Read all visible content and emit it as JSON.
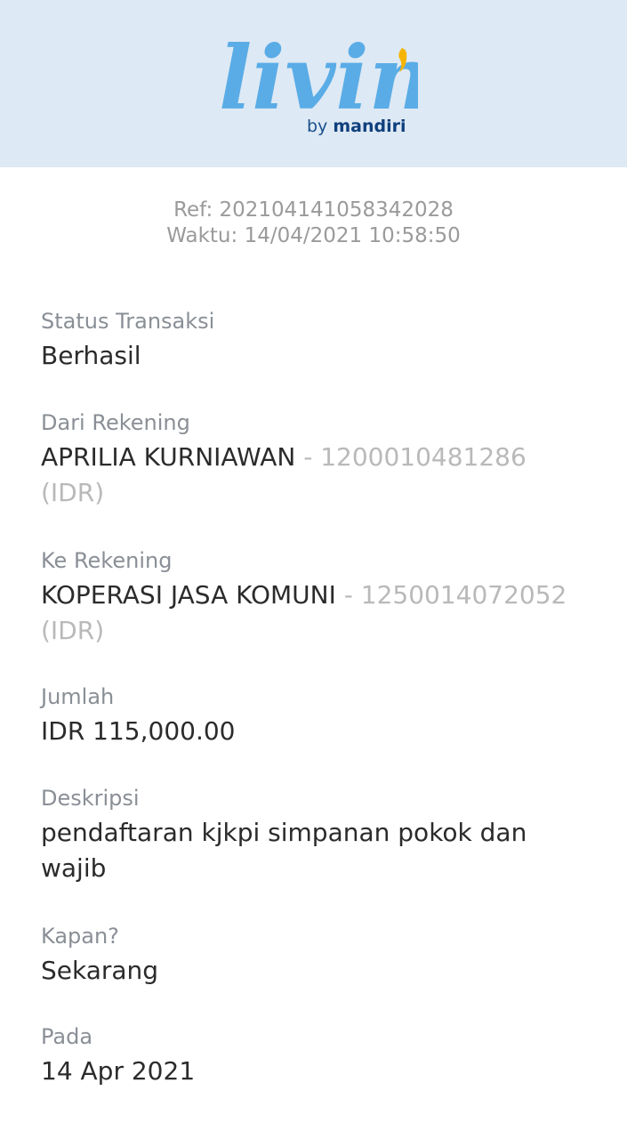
{
  "header": {
    "logo_word": "livin'",
    "logo_by": "by",
    "logo_brand": "mandiri"
  },
  "meta": {
    "ref": "Ref: 202104141058342028",
    "time": "Waktu: 14/04/2021 10:58:50"
  },
  "fields": {
    "status": {
      "label": "Status Transaksi",
      "value": "Berhasil"
    },
    "from": {
      "label": "Dari Rekening",
      "name": "APRILIA KURNIAWAN",
      "account": " - 1200010481286 (IDR)"
    },
    "to": {
      "label": "Ke Rekening",
      "name": "KOPERASI JASA KOMUNI",
      "account": " - 1250014072052 (IDR)"
    },
    "amount": {
      "label": "Jumlah",
      "value": "IDR 115,000.00"
    },
    "description": {
      "label": "Deskripsi",
      "value": "pendaftaran kjkpi simpanan pokok dan wajib"
    },
    "when": {
      "label": "Kapan?",
      "value": "Sekarang"
    },
    "date": {
      "label": "Pada",
      "value": "14 Apr 2021"
    }
  },
  "colors": {
    "header_bg": "#dde9f4",
    "logo_blue": "#5aace6",
    "logo_accent": "#f5b400",
    "brand_navy": "#0f3f7d"
  }
}
